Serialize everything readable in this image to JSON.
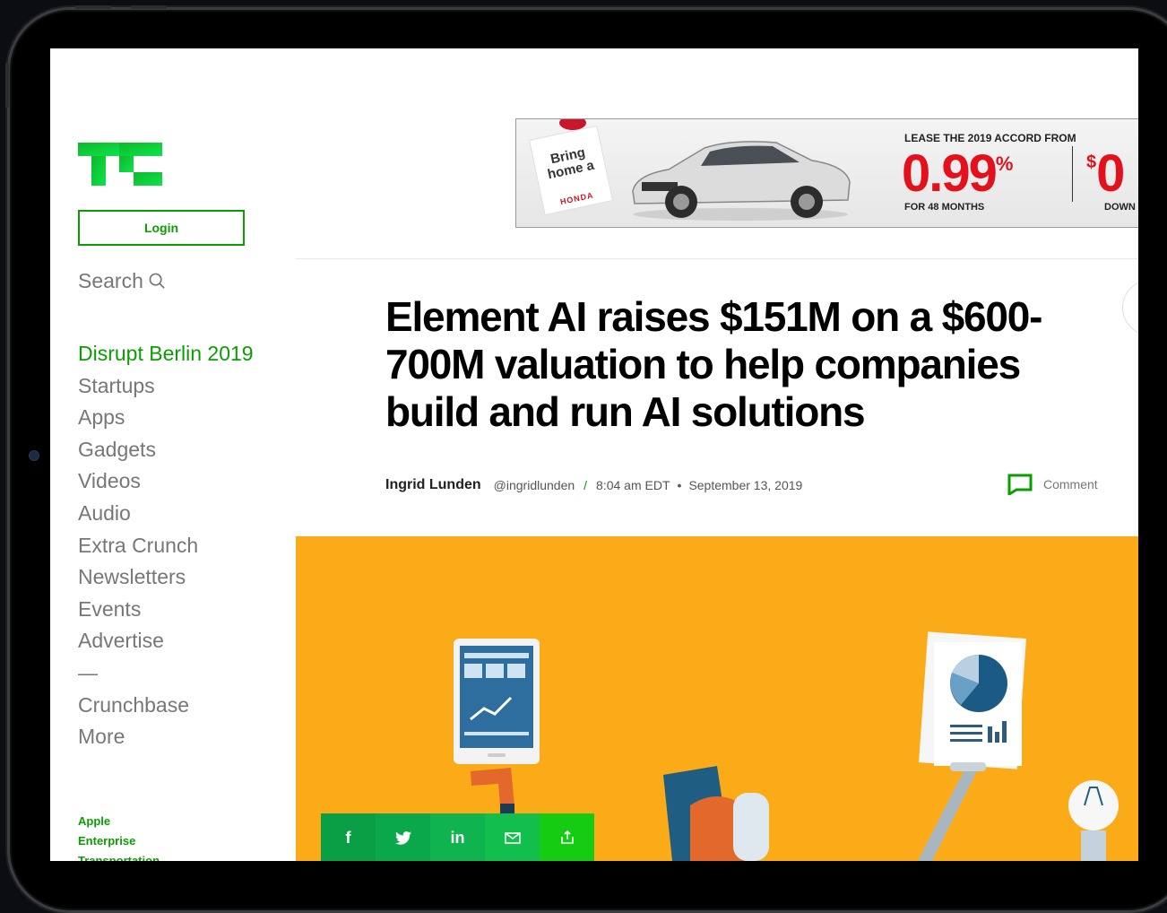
{
  "nav": {
    "login_label": "Login",
    "search_label": "Search",
    "items": [
      "Disrupt Berlin 2019",
      "Startups",
      "Apps",
      "Gadgets",
      "Videos",
      "Audio",
      "Extra Crunch",
      "Newsletters",
      "Events",
      "Advertise"
    ],
    "separator": "—",
    "more_items": [
      "Crunchbase",
      "More"
    ],
    "tags": [
      "Apple",
      "Enterprise",
      "Transportation"
    ]
  },
  "ad": {
    "tag_text": "Bring home a",
    "brand": "HONDA",
    "lease_text": "LEASE THE 2019 ACCORD FROM",
    "rate": "0.99",
    "rate_unit": "%",
    "term": "FOR 48 MONTHS",
    "dollar": "$",
    "down_amount": "0",
    "down_label": "DOWN"
  },
  "article": {
    "title": "Element AI raises $151M on a $600-700M valuation to help companies build and run AI solutions",
    "author": "Ingrid Lunden",
    "handle": "@ingridlunden",
    "slash": "/",
    "time": "8:04 am EDT",
    "dot": "•",
    "date": "September 13, 2019",
    "comment_label": "Comment"
  },
  "share": {
    "facebook": "f",
    "twitter": "t",
    "linkedin": "in"
  },
  "colors": {
    "brand_green": "#0a9e01",
    "hero_orange": "#fbab17",
    "ad_red": "#e2111c"
  }
}
